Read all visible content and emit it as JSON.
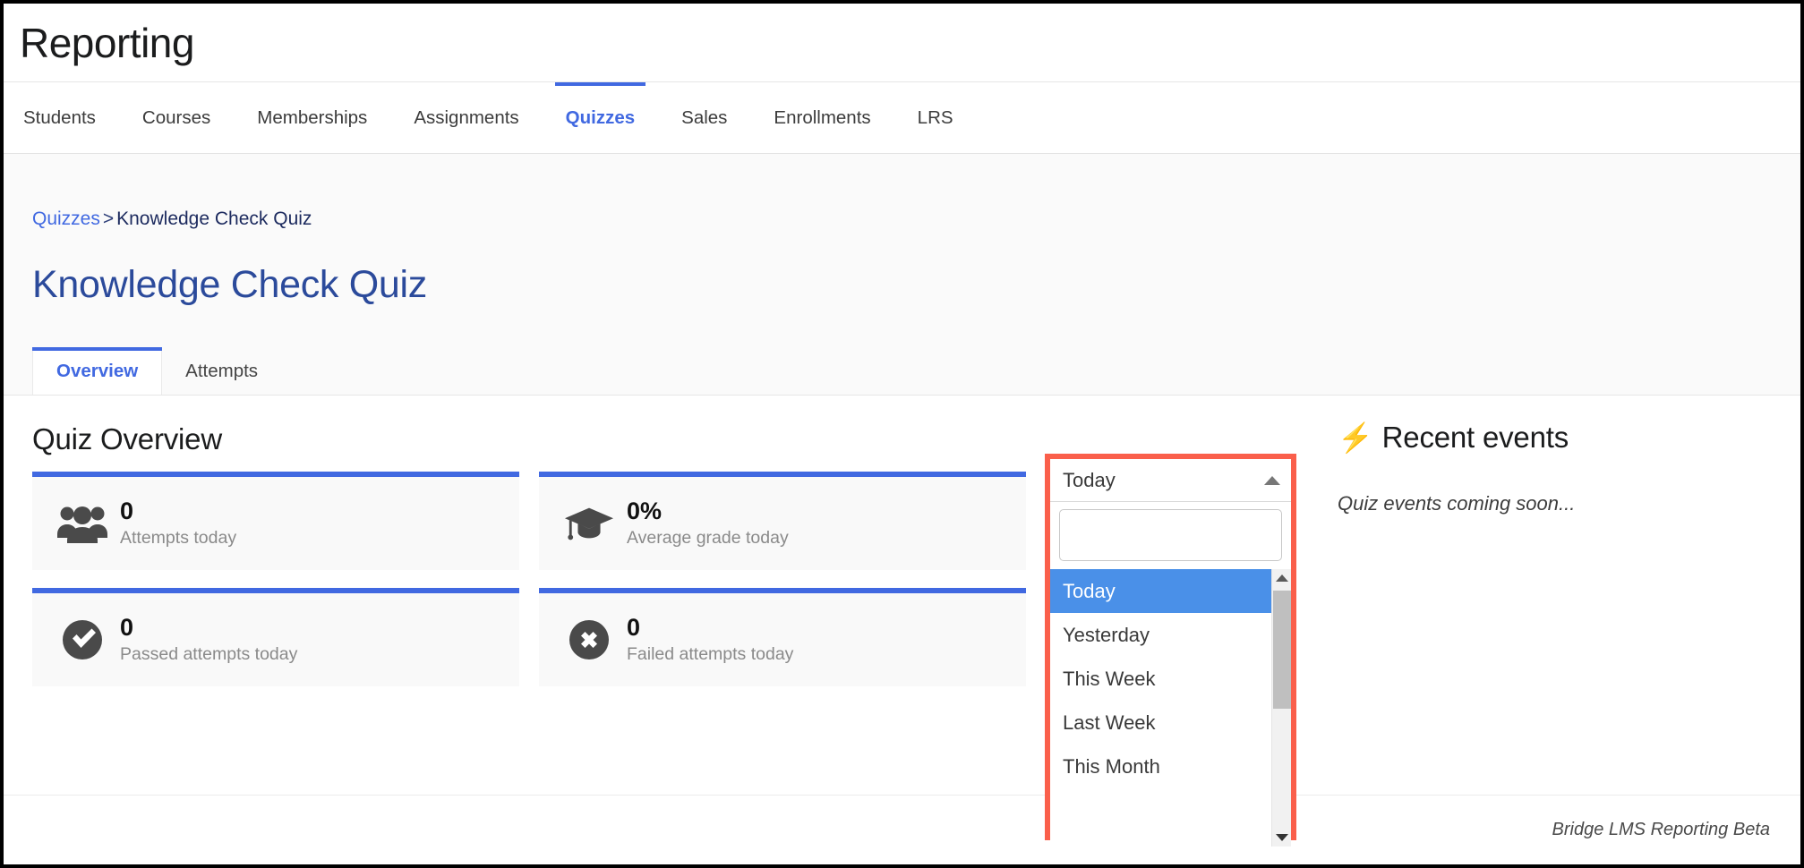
{
  "app": {
    "title": "Reporting"
  },
  "nav": {
    "items": [
      {
        "label": "Students",
        "active": false
      },
      {
        "label": "Courses",
        "active": false
      },
      {
        "label": "Memberships",
        "active": false
      },
      {
        "label": "Assignments",
        "active": false
      },
      {
        "label": "Quizzes",
        "active": true
      },
      {
        "label": "Sales",
        "active": false
      },
      {
        "label": "Enrollments",
        "active": false
      },
      {
        "label": "LRS",
        "active": false
      }
    ],
    "accent_color": "#4169e1"
  },
  "breadcrumb": {
    "root": "Quizzes",
    "separator": ">",
    "current": "Knowledge Check Quiz"
  },
  "page": {
    "heading": "Knowledge Check Quiz",
    "heading_color": "#2b4a9b"
  },
  "tabs": [
    {
      "label": "Overview",
      "active": true
    },
    {
      "label": "Attempts",
      "active": false
    }
  ],
  "overview": {
    "section_title": "Quiz Overview",
    "card_accent_color": "#4169e1",
    "cards": [
      {
        "icon": "users-icon",
        "value": "0",
        "label": "Attempts today"
      },
      {
        "icon": "graduation-cap-icon",
        "value": "0%",
        "label": "Average grade today"
      },
      {
        "icon": "check-circle-icon",
        "value": "0",
        "label": "Passed attempts today"
      },
      {
        "icon": "x-circle-icon",
        "value": "0",
        "label": "Failed attempts today"
      }
    ]
  },
  "date_filter": {
    "icon": "chevron-up-icon",
    "selected": "Today",
    "search_value": "",
    "search_placeholder": "",
    "highlight_color": "#fa5f4b",
    "selected_option_color": "#4a90e8",
    "options": [
      {
        "label": "Today",
        "selected": true
      },
      {
        "label": "Yesterday",
        "selected": false
      },
      {
        "label": "This Week",
        "selected": false
      },
      {
        "label": "Last Week",
        "selected": false
      },
      {
        "label": "This Month",
        "selected": false
      }
    ]
  },
  "events": {
    "icon": "bolt-icon",
    "bolt_glyph": "⚡",
    "title": "Recent events",
    "empty_message": "Quiz events coming soon..."
  },
  "footer": {
    "text": "Bridge LMS Reporting Beta"
  }
}
